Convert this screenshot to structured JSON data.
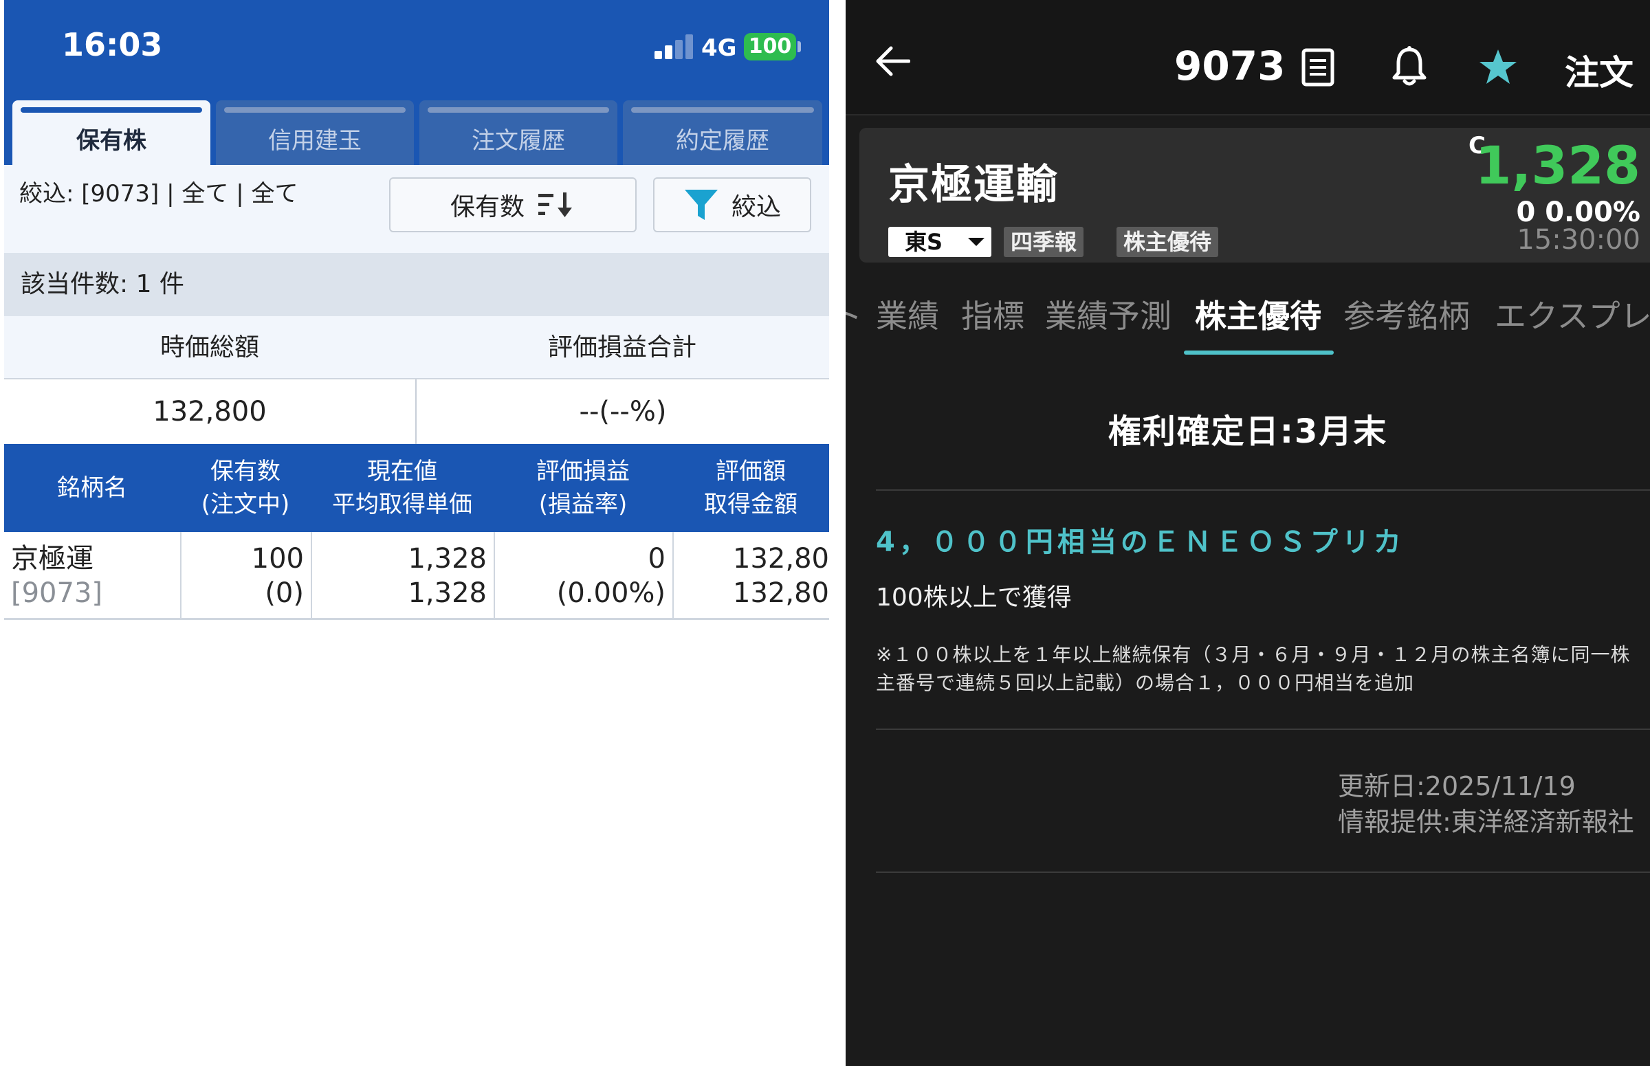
{
  "left": {
    "status": {
      "time": "16:03",
      "network": "4G",
      "battery": "100"
    },
    "tabs": [
      {
        "label": "保有株"
      },
      {
        "label": "信用建玉"
      },
      {
        "label": "注文履歴"
      },
      {
        "label": "約定履歴"
      }
    ],
    "filter_text": "絞込: [9073] | 全て | 全て",
    "sort_button": "保有数",
    "filter_button": "絞込",
    "count_text": "該当件数: 1 件",
    "summary": {
      "market_value_label": "時価総額",
      "pl_total_label": "評価損益合計",
      "market_value": "132,800",
      "pl_total": "--(--%)"
    },
    "columns": [
      {
        "line1": "銘柄名",
        "line2": ""
      },
      {
        "line1": "保有数",
        "line2": "(注文中)"
      },
      {
        "line1": "現在値",
        "line2": "平均取得単価"
      },
      {
        "line1": "評価損益",
        "line2": "(損益率)"
      },
      {
        "line1": "評価額",
        "line2": "取得金額"
      }
    ],
    "row": {
      "name": "京極運",
      "code": "[9073]",
      "qty": "100",
      "qty_pending": "(0)",
      "price": "1,328",
      "avg_cost": "1,328",
      "pl": "0",
      "pl_rate": "(0.00%)",
      "value": "132,80",
      "cost": "132,80"
    }
  },
  "right": {
    "code": "9073",
    "order_label": "注文",
    "stock_name": "京極運輸",
    "market": "東S",
    "badges": [
      "四季報",
      "株主優待"
    ],
    "c_mark": "C",
    "price": "1,328",
    "change": "0",
    "change_pct": "0.00%",
    "price_time": "15:30:00",
    "subtabs": [
      "ト",
      "業績",
      "指標",
      "業績予測",
      "株主優待",
      "参考銘柄",
      "エクスプレ"
    ],
    "rights_date": "権利確定日:3月末",
    "benefit_title": "4，０００円相当のＥＮＥＯＳプリカ",
    "benefit_cond": "100株以上で獲得",
    "benefit_note": "※１００株以上を１年以上継続保有（３月・６月・９月・１２月の株主名簿に同一株主番号で連続５回以上記載）の場合１，０００円相当を追加",
    "updated": "更新日:2025/11/19",
    "provider": "情報提供:東洋経済新報社"
  },
  "colors": {
    "header_blue": "#1a56b3",
    "price_green": "#40c95a",
    "accent_teal": "#4fc2c9",
    "star_teal": "#56c6ce",
    "dark_bg": "#1b1b1b"
  }
}
